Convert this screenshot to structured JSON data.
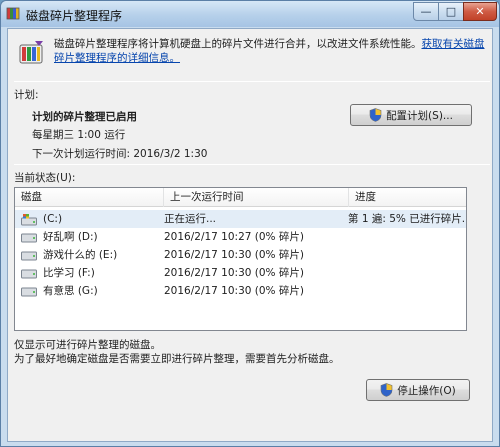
{
  "window": {
    "title": "磁盘碎片整理程序",
    "minimize_glyph": "—",
    "maximize_glyph": "□",
    "close_glyph": "✕"
  },
  "header": {
    "description": "磁盘碎片整理程序将计算机硬盘上的碎片文件进行合并，以改进文件系统性能。",
    "link": "获取有关磁盘碎片整理程序的详细信息。"
  },
  "schedule": {
    "section_label": "计划:",
    "status": "计划的碎片整理已启用",
    "frequency": "每星期三 1:00 运行",
    "next_run": "下一次计划运行时间: 2016/3/2 1:30",
    "configure_button": "配置计划(S)..."
  },
  "current_status": {
    "section_label": "当前状态(U):",
    "columns": [
      "磁盘",
      "上一次运行时间",
      "进度"
    ],
    "rows": [
      {
        "disk": "(C:)",
        "last_run": "正在运行...",
        "progress": "第 1 遍: 5% 已进行碎片..."
      },
      {
        "disk": "好乱啊 (D:)",
        "last_run": "2016/2/17 10:27 (0% 碎片)",
        "progress": ""
      },
      {
        "disk": "游戏什么的 (E:)",
        "last_run": "2016/2/17 10:30 (0% 碎片)",
        "progress": ""
      },
      {
        "disk": "比学习 (F:)",
        "last_run": "2016/2/17 10:30 (0% 碎片)",
        "progress": ""
      },
      {
        "disk": "有意思 (G:)",
        "last_run": "2016/2/17 10:30 (0% 碎片)",
        "progress": ""
      }
    ]
  },
  "notes": {
    "line1": "仅显示可进行碎片整理的磁盘。",
    "line2": "为了最好地确定磁盘是否需要立即进行碎片整理，需要首先分析磁盘。"
  },
  "actions": {
    "stop_button": "停止操作(O)"
  },
  "icons": {
    "app": "defrag-app-icon",
    "shield": "uac-shield-icon",
    "system_drive": "system-drive-icon",
    "drive": "hard-drive-icon"
  },
  "colors": {
    "titlebar": "#b6d0ea",
    "link": "#0645ad",
    "selected_row": "#e3edf7",
    "close_button": "#cf5b44"
  }
}
